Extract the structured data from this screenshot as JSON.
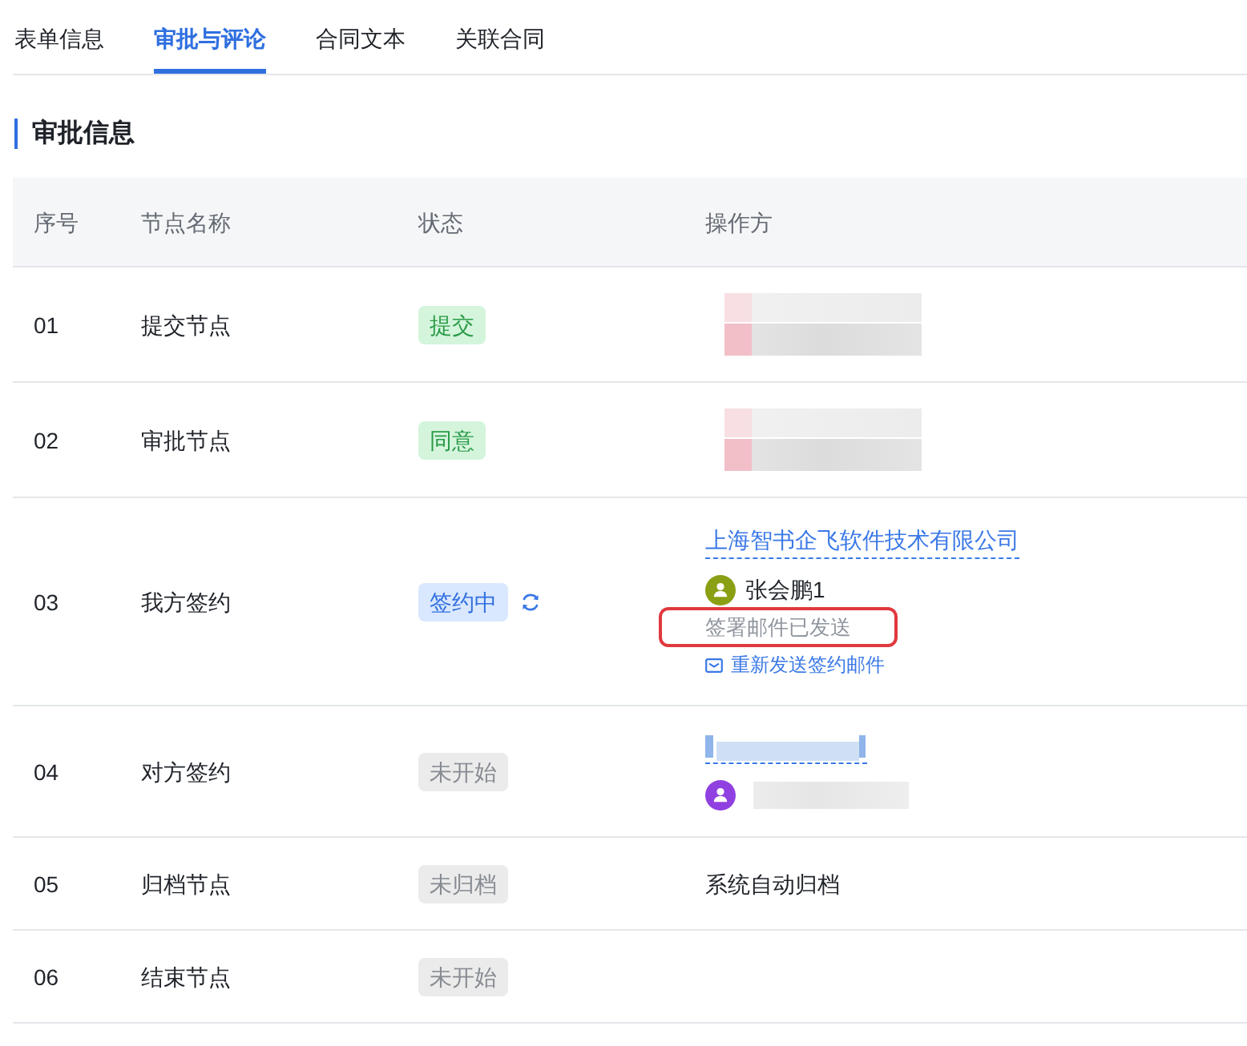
{
  "tabs": [
    {
      "label": "表单信息",
      "selected": false
    },
    {
      "label": "审批与评论",
      "selected": true
    },
    {
      "label": "合同文本",
      "selected": false
    },
    {
      "label": "关联合同",
      "selected": false
    }
  ],
  "section": {
    "title": "审批信息"
  },
  "table": {
    "columns": [
      "序号",
      "节点名称",
      "状态",
      "操作方"
    ],
    "rows": [
      {
        "index": "01",
        "node": "提交节点",
        "status": {
          "label": "提交",
          "kind": "success",
          "syncing": false
        },
        "operator": {
          "kind": "redacted"
        }
      },
      {
        "index": "02",
        "node": "审批节点",
        "status": {
          "label": "同意",
          "kind": "success",
          "syncing": false
        },
        "operator": {
          "kind": "redacted"
        }
      },
      {
        "index": "03",
        "node": "我方签约",
        "status": {
          "label": "签约中",
          "kind": "processing",
          "syncing": true
        },
        "operator": {
          "kind": "signer",
          "company": "上海智书企飞软件技术有限公司",
          "person": {
            "name": "张会鹏1",
            "color": "#8a9f13"
          },
          "note": {
            "text": "签署邮件已发送",
            "highlighted": true
          },
          "action": "重新发送签约邮件"
        }
      },
      {
        "index": "04",
        "node": "对方签约",
        "status": {
          "label": "未开始",
          "kind": "neutral",
          "syncing": false
        },
        "operator": {
          "kind": "signer_redacted",
          "person": {
            "color": "#9040e0"
          }
        }
      },
      {
        "index": "05",
        "node": "归档节点",
        "status": {
          "label": "未归档",
          "kind": "neutral",
          "syncing": false
        },
        "operator": {
          "kind": "text",
          "text": "系统自动归档"
        }
      },
      {
        "index": "06",
        "node": "结束节点",
        "status": {
          "label": "未开始",
          "kind": "neutral",
          "syncing": false
        }
      }
    ]
  }
}
